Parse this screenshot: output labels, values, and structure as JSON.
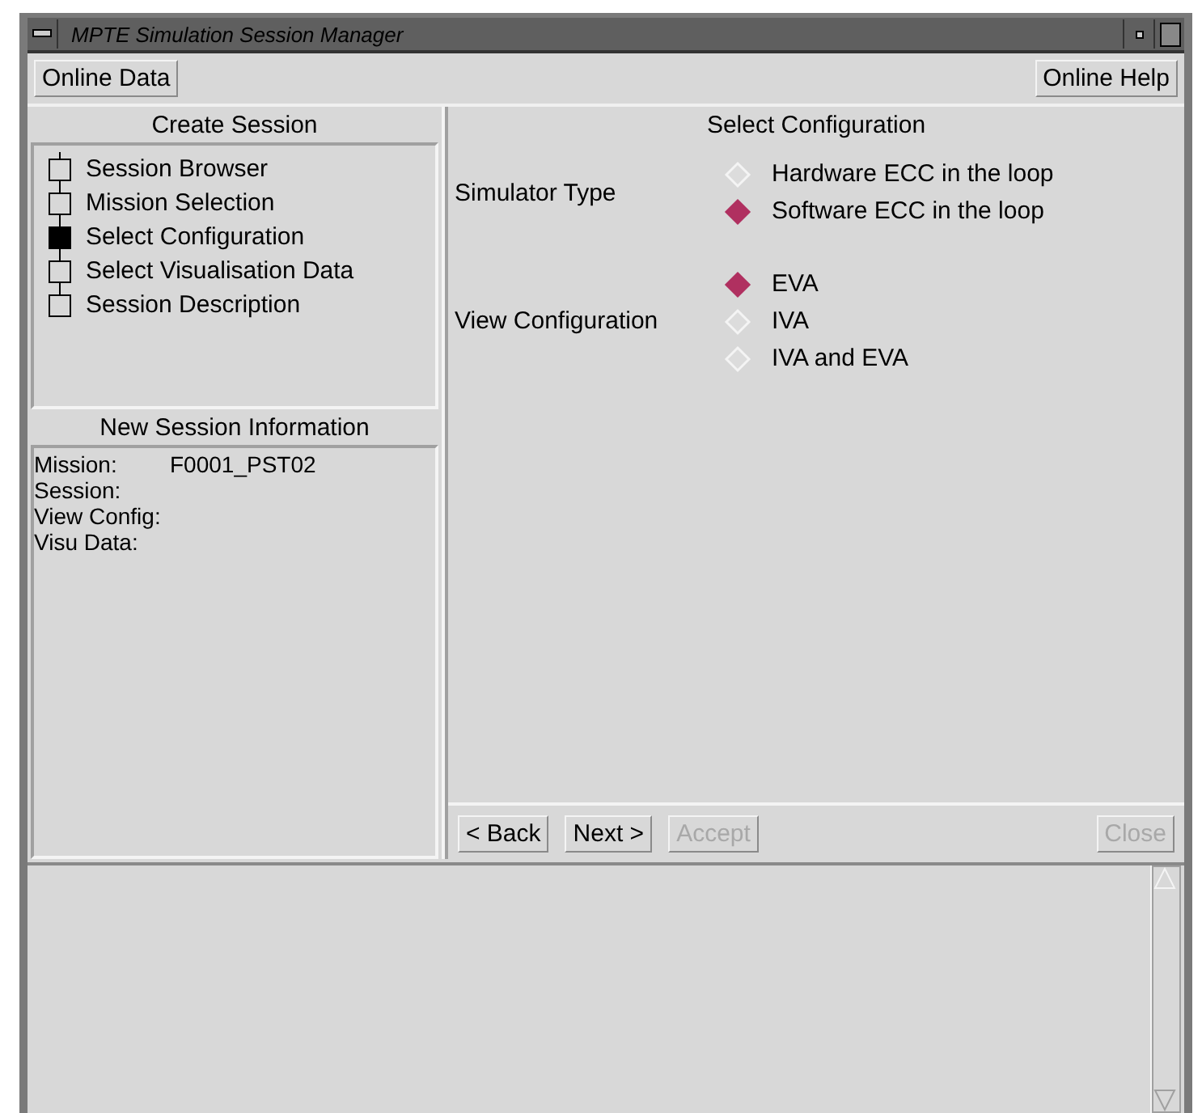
{
  "window": {
    "title": "MPTE Simulation Session Manager"
  },
  "toolbar": {
    "left_button": "Online Data",
    "right_button": "Online Help"
  },
  "create_session": {
    "title": "Create Session",
    "steps": [
      {
        "label": "Session Browser",
        "selected": false
      },
      {
        "label": "Mission Selection",
        "selected": false
      },
      {
        "label": "Select Configuration",
        "selected": true
      },
      {
        "label": "Select Visualisation Data",
        "selected": false
      },
      {
        "label": "Session Description",
        "selected": false
      }
    ]
  },
  "session_info": {
    "title": "New Session Information",
    "fields": [
      {
        "label": "Mission:",
        "value": "F0001_PST02"
      },
      {
        "label": "Session:"
      },
      {
        "label": "View Config:"
      },
      {
        "label": "Visu Data:"
      }
    ]
  },
  "configuration": {
    "title": "Select Configuration",
    "groups": [
      {
        "label": "Simulator Type",
        "options": [
          {
            "label": "Hardware ECC in the loop",
            "selected": false
          },
          {
            "label": "Software ECC in the loop",
            "selected": true
          }
        ]
      },
      {
        "label": "View Configuration",
        "options": [
          {
            "label": "EVA",
            "selected": true
          },
          {
            "label": "IVA",
            "selected": false
          },
          {
            "label": "IVA and EVA",
            "selected": false
          }
        ]
      }
    ]
  },
  "nav_buttons": [
    {
      "label": "< Back",
      "disabled": false
    },
    {
      "label": "Next >",
      "disabled": false
    },
    {
      "label": "Accept",
      "disabled": true
    }
  ],
  "close_button": {
    "label": "Close",
    "disabled": true
  }
}
